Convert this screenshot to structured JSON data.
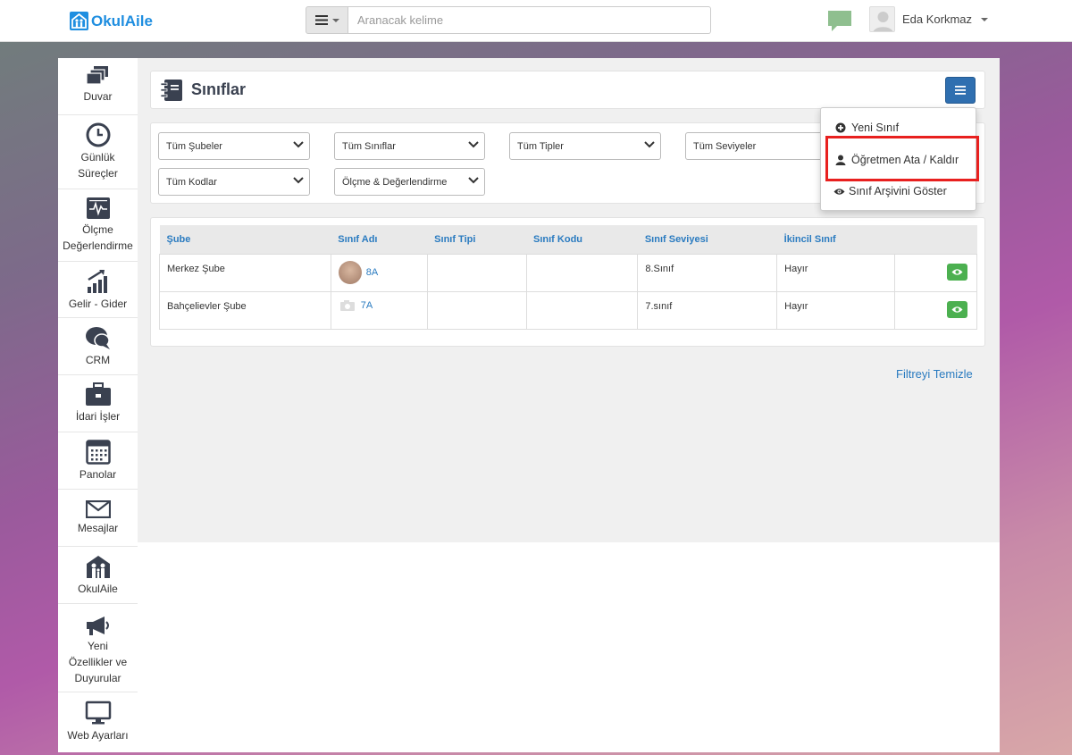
{
  "brand": {
    "name": "OkulAile",
    "accent": "#1f8ee0"
  },
  "search": {
    "placeholder": "Aranacak kelime"
  },
  "user": {
    "name": "Eda Korkmaz"
  },
  "sidebar": {
    "items": [
      {
        "label": "Duvar",
        "icon": "layers-icon"
      },
      {
        "label": "Günlük Süreçler",
        "icon": "clock-icon"
      },
      {
        "label": "Ölçme Değerlendirme",
        "icon": "monitor-chart-icon"
      },
      {
        "label": "Gelir - Gider",
        "icon": "bar-growth-icon"
      },
      {
        "label": "CRM",
        "icon": "chat-bubbles-icon"
      },
      {
        "label": "İdari İşler",
        "icon": "briefcase-icon"
      },
      {
        "label": "Panolar",
        "icon": "calendar-board-icon"
      },
      {
        "label": "Mesajlar",
        "icon": "envelope-icon"
      },
      {
        "label": "OkulAile",
        "icon": "family-icon"
      },
      {
        "label": "Yeni Özellikler ve Duyurular",
        "icon": "megaphone-icon"
      },
      {
        "label": "Web Ayarları",
        "icon": "desktop-icon"
      }
    ]
  },
  "page": {
    "title": "Sınıflar"
  },
  "filters": {
    "row1": [
      "Tüm Şubeler",
      "Tüm Sınıflar",
      "Tüm Tipler",
      "Tüm Seviyeler"
    ],
    "row2": [
      "Tüm Kodlar",
      "Ölçme & Değerlendirme"
    ]
  },
  "table": {
    "headers": [
      "Şube",
      "Sınıf Adı",
      "Sınıf Tipi",
      "Sınıf Kodu",
      "Sınıf Seviyesi",
      "İkincil Sınıf"
    ],
    "rows": [
      {
        "sube": "Merkez Şube",
        "sinif_adi": "8A",
        "sinif_tipi": "",
        "sinif_kodu": "",
        "seviye": "8.Sınıf",
        "ikincil": "Hayır"
      },
      {
        "sube": "Bahçelievler Şube",
        "sinif_adi": "7A",
        "sinif_tipi": "",
        "sinif_kodu": "",
        "seviye": "7.sınıf",
        "ikincil": "Hayır"
      }
    ]
  },
  "actions": {
    "clear_filter": "Filtreyi Temizle"
  },
  "dropdown": {
    "items": [
      {
        "label": "Yeni Sınıf",
        "icon": "plus-circle-icon"
      },
      {
        "label": "Öğretmen Ata / Kaldır",
        "icon": "user-icon"
      },
      {
        "label": "Sınıf Arşivini Göster",
        "icon": "eye-icon"
      }
    ],
    "highlight_color": "#e8201f"
  }
}
